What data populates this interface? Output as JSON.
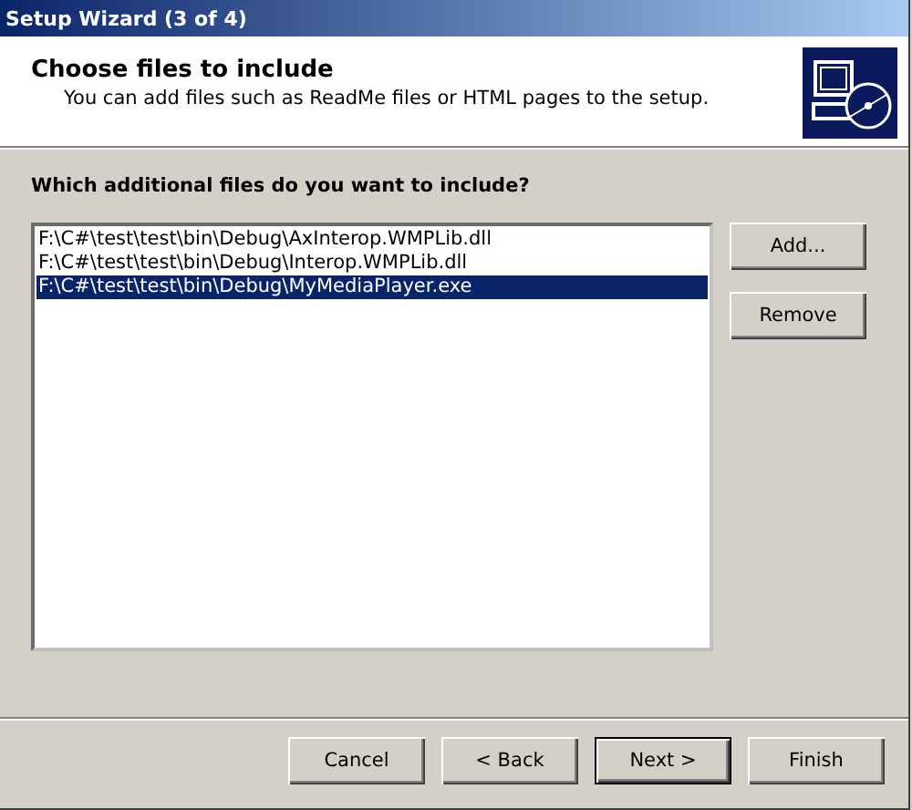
{
  "window": {
    "title": "Setup Wizard (3 of 4)"
  },
  "header": {
    "title": "Choose files to include",
    "subtitle": "You can add files such as ReadMe files or HTML pages to the setup."
  },
  "prompt": {
    "label": "Which additional files do you want to include?"
  },
  "files": [
    {
      "path": "F:\\C#\\test\\test\\bin\\Debug\\AxInterop.WMPLib.dll",
      "selected": false
    },
    {
      "path": "F:\\C#\\test\\test\\bin\\Debug\\Interop.WMPLib.dll",
      "selected": false
    },
    {
      "path": "F:\\C#\\test\\test\\bin\\Debug\\MyMediaPlayer.exe",
      "selected": true
    }
  ],
  "side_buttons": [
    {
      "label": "Add..."
    },
    {
      "label": "Remove"
    }
  ],
  "footer_buttons": [
    {
      "label": "Cancel",
      "default": false
    },
    {
      "label": "< Back",
      "default": false
    },
    {
      "label": "Next >",
      "default": true
    },
    {
      "label": "Finish",
      "default": false
    }
  ]
}
